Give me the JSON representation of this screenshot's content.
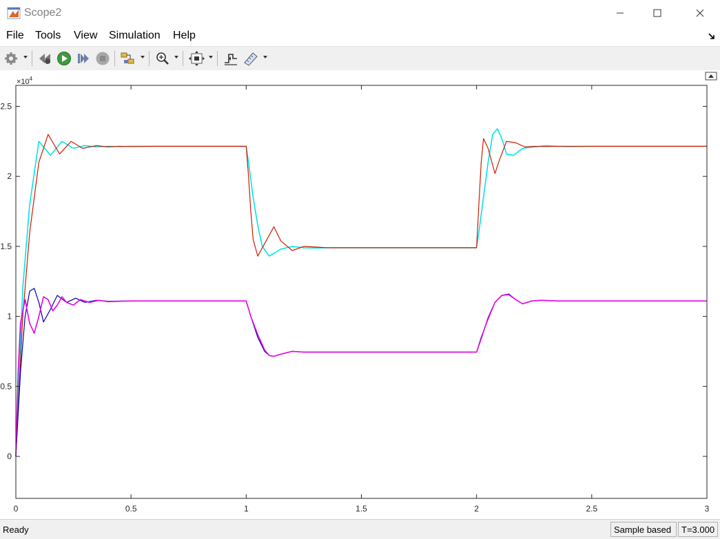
{
  "window": {
    "title": "Scope2"
  },
  "menu": {
    "file": "File",
    "tools": "Tools",
    "view": "View",
    "simulation": "Simulation",
    "help": "Help"
  },
  "toolbar": {
    "icons": [
      "gear-icon",
      "rewind-icon",
      "run-icon",
      "step-forward-icon",
      "stop-icon",
      "highlight-block-icon",
      "zoom-icon",
      "autoscale-icon",
      "triggers-icon",
      "measurements-icon"
    ]
  },
  "status": {
    "left": "Ready",
    "mode": "Sample based",
    "time": "T=3.000"
  },
  "chart_data": {
    "type": "line",
    "title": "",
    "xlabel": "",
    "ylabel": "",
    "y_exponent_label": "×10",
    "y_exponent_power": "4",
    "xlim": [
      0,
      3
    ],
    "ylim": [
      -0.3,
      2.65
    ],
    "xticks": [
      0,
      0.5,
      1,
      1.5,
      2,
      2.5,
      3
    ],
    "xtick_labels": [
      "0",
      "0.5",
      "1",
      "1.5",
      "2",
      "2.5",
      "3"
    ],
    "yticks": [
      0,
      0.5,
      1,
      1.5,
      2,
      2.5
    ],
    "ytick_labels": [
      "0",
      "0.5",
      "1",
      "1.5",
      "2",
      "2.5"
    ],
    "grid": false,
    "background": "#ffffff",
    "series": [
      {
        "color": "#00e5e5",
        "x": [
          0,
          0.03,
          0.06,
          0.1,
          0.15,
          0.2,
          0.25,
          0.3,
          0.35,
          0.4,
          0.45,
          0.5,
          0.6,
          1.0,
          1.01,
          1.03,
          1.05,
          1.07,
          1.1,
          1.12,
          1.15,
          1.2,
          1.25,
          1.3,
          1.35,
          1.4,
          2.0,
          2.01,
          2.03,
          2.05,
          2.07,
          2.09,
          2.11,
          2.13,
          2.16,
          2.2,
          2.25,
          2.3,
          2.35,
          2.4,
          2.5,
          3.0
        ],
        "y": [
          0,
          1.2,
          1.8,
          2.25,
          2.15,
          2.25,
          2.2,
          2.22,
          2.21,
          2.215,
          2.213,
          2.215,
          2.215,
          2.215,
          2.1,
          1.85,
          1.65,
          1.5,
          1.43,
          1.45,
          1.48,
          1.5,
          1.49,
          1.488,
          1.49,
          1.49,
          1.49,
          1.6,
          1.85,
          2.1,
          2.3,
          2.34,
          2.27,
          2.16,
          2.15,
          2.2,
          2.21,
          2.22,
          2.215,
          2.213,
          2.215,
          2.215
        ]
      },
      {
        "color": "#d01a00",
        "x": [
          0,
          0.03,
          0.06,
          0.1,
          0.14,
          0.19,
          0.24,
          0.29,
          0.35,
          0.4,
          0.45,
          0.5,
          0.6,
          1.0,
          1.01,
          1.02,
          1.03,
          1.05,
          1.08,
          1.12,
          1.15,
          1.2,
          1.25,
          1.3,
          1.35,
          1.4,
          2.0,
          2.01,
          2.02,
          2.03,
          2.05,
          2.08,
          2.1,
          2.13,
          2.17,
          2.21,
          2.25,
          2.3,
          2.35,
          2.5,
          3.0
        ],
        "y": [
          0,
          1.0,
          1.6,
          2.1,
          2.3,
          2.16,
          2.25,
          2.2,
          2.22,
          2.21,
          2.215,
          2.213,
          2.215,
          2.215,
          2.0,
          1.75,
          1.55,
          1.43,
          1.52,
          1.64,
          1.54,
          1.47,
          1.5,
          1.495,
          1.49,
          1.49,
          1.49,
          1.8,
          2.1,
          2.27,
          2.2,
          2.02,
          2.12,
          2.25,
          2.24,
          2.21,
          2.215,
          2.213,
          2.215,
          2.215,
          2.215
        ]
      },
      {
        "color": "#0000b4",
        "x": [
          0,
          0.02,
          0.04,
          0.06,
          0.08,
          0.1,
          0.12,
          0.15,
          0.18,
          0.22,
          0.26,
          0.3,
          0.35,
          0.4,
          0.5,
          0.6,
          1.0,
          1.02,
          1.05,
          1.08,
          1.1,
          1.12,
          1.15,
          1.2,
          1.25,
          1.3,
          1.4,
          2.0,
          2.02,
          2.05,
          2.08,
          2.11,
          2.14,
          2.17,
          2.2,
          2.24,
          2.28,
          2.35,
          2.5,
          3.0
        ],
        "y": [
          0,
          0.6,
          1.0,
          1.18,
          1.2,
          1.1,
          0.96,
          1.05,
          1.15,
          1.1,
          1.13,
          1.1,
          1.115,
          1.108,
          1.11,
          1.11,
          1.11,
          1.0,
          0.85,
          0.75,
          0.72,
          0.715,
          0.73,
          0.75,
          0.745,
          0.745,
          0.745,
          0.745,
          0.85,
          0.98,
          1.1,
          1.15,
          1.16,
          1.12,
          1.09,
          1.11,
          1.115,
          1.11,
          1.11,
          1.11
        ]
      },
      {
        "color": "#e600e6",
        "x": [
          0,
          0.01,
          0.02,
          0.04,
          0.06,
          0.08,
          0.1,
          0.12,
          0.14,
          0.16,
          0.18,
          0.2,
          0.22,
          0.25,
          0.28,
          0.32,
          0.36,
          0.4,
          0.5,
          0.6,
          1.0,
          1.02,
          1.05,
          1.08,
          1.1,
          1.12,
          1.15,
          1.2,
          1.25,
          1.3,
          1.4,
          2.0,
          2.02,
          2.05,
          2.08,
          2.11,
          2.14,
          2.17,
          2.2,
          2.24,
          2.28,
          2.35,
          2.5,
          3.0
        ],
        "y": [
          0,
          0.6,
          0.95,
          1.12,
          0.95,
          0.88,
          1.0,
          1.14,
          1.12,
          1.04,
          1.08,
          1.14,
          1.1,
          1.08,
          1.12,
          1.1,
          1.115,
          1.105,
          1.11,
          1.11,
          1.11,
          1.0,
          0.87,
          0.76,
          0.72,
          0.715,
          0.73,
          0.75,
          0.745,
          0.745,
          0.745,
          0.745,
          0.84,
          0.99,
          1.1,
          1.15,
          1.155,
          1.12,
          1.09,
          1.11,
          1.115,
          1.11,
          1.11,
          1.11
        ]
      }
    ]
  }
}
